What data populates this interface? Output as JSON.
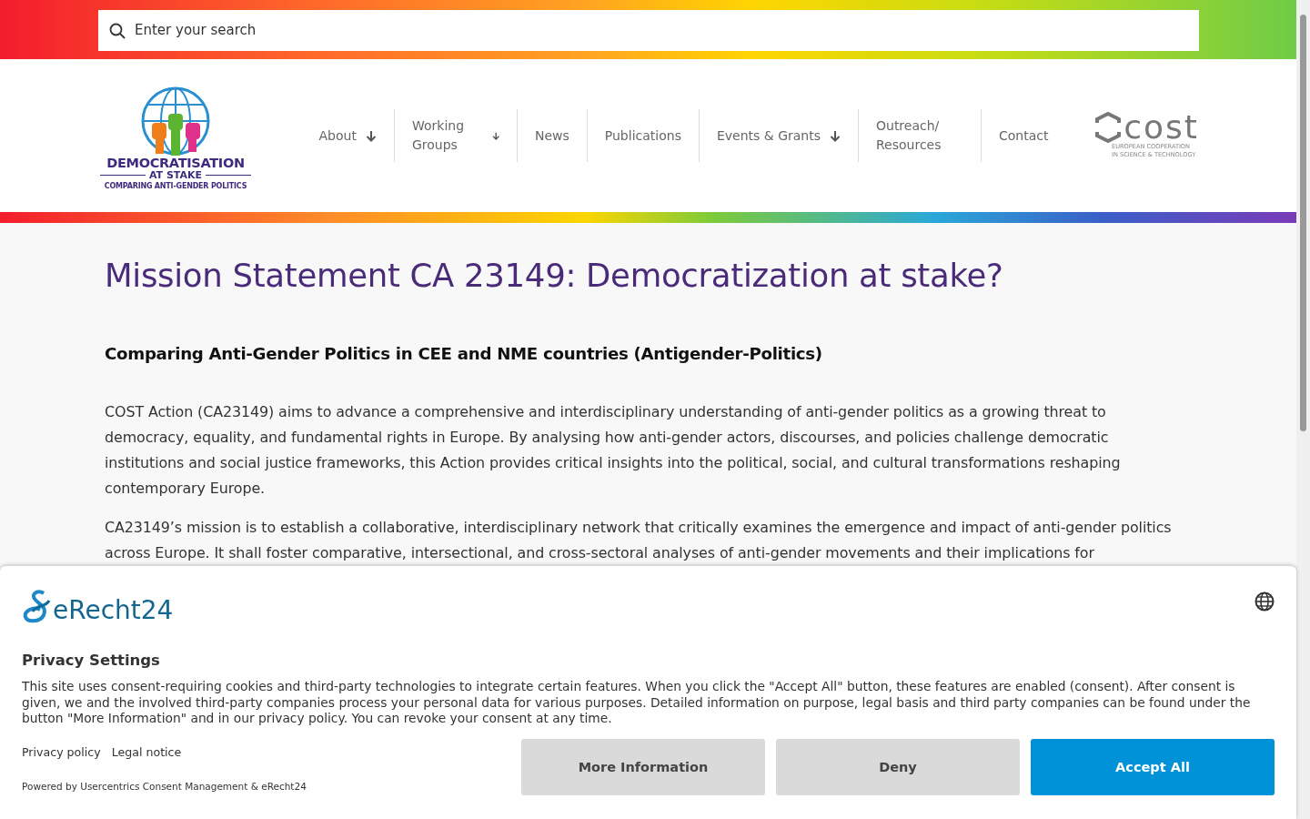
{
  "search": {
    "placeholder": "Enter your search"
  },
  "logo": {
    "title": "DEMOCRATISATION",
    "subtitle": "AT STAKE",
    "tagline": "COMPARING ANTI-GENDER POLITICS"
  },
  "nav": [
    {
      "label": "About",
      "dropdown": true
    },
    {
      "label": "Working Groups",
      "dropdown": true
    },
    {
      "label": "News",
      "dropdown": false
    },
    {
      "label": "Publications",
      "dropdown": false
    },
    {
      "label": "Events & Grants",
      "dropdown": true
    },
    {
      "label": "Outreach/ Resources",
      "dropdown": false
    },
    {
      "label": "Contact",
      "dropdown": false
    }
  ],
  "partner_logo": {
    "name": "cost",
    "line1": "EUROPEAN COOPERATION",
    "line2": "IN SCIENCE & TECHNOLOGY"
  },
  "page": {
    "title": "Mission Statement CA 23149: Democratization at stake?",
    "subtitle": "Comparing Anti-Gender Politics in CEE and NME countries (Antigender-Politics)",
    "paragraphs": [
      "COST Action (CA23149) aims to advance a comprehensive and interdisciplinary understanding of anti-gender politics as a growing threat to democracy, equality, and fundamental rights in Europe. By analysing how anti-gender actors, discourses, and policies challenge democratic institutions and social justice frameworks, this Action provides critical insights into the political, social, and cultural transformations reshaping contemporary Europe.",
      "CA23149’s mission is to establish a collaborative, interdisciplinary network that critically examines the emergence and impact of anti-gender politics across Europe. It shall foster comparative, intersectional, and cross-sectoral analyses of anti-gender movements and their implications for"
    ]
  },
  "consent": {
    "brand": "eRecht24",
    "title": "Privacy Settings",
    "text": "This site uses consent-requiring cookies and third-party technologies to integrate certain features. When you click the \"Accept All\" button, these features are enabled (consent). After consent is given, we and the involved third-party companies process your personal data for various purposes. Detailed information on purpose, legal basis and third party companies can be found under the button \"More Information\" and in our privacy policy. You can revoke your consent at any time.",
    "links": [
      "Privacy policy",
      "Legal notice"
    ],
    "powered_by": "Powered by Usercentrics Consent Management & eRecht24",
    "buttons": [
      {
        "label": "More Information",
        "kind": "secondary"
      },
      {
        "label": "Deny",
        "kind": "secondary"
      },
      {
        "label": "Accept All",
        "kind": "primary"
      }
    ]
  }
}
